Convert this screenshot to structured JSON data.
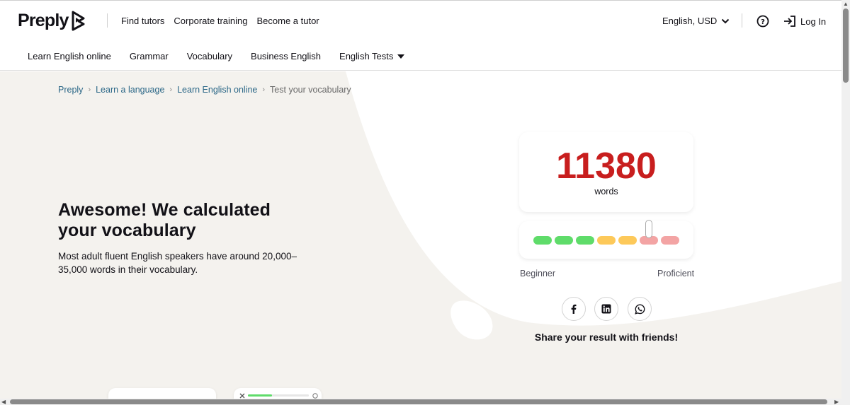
{
  "header": {
    "logo": "Preply",
    "links": [
      "Find tutors",
      "Corporate training",
      "Become a tutor"
    ],
    "locale": "English, USD",
    "login": "Log In"
  },
  "subnav": [
    "Learn English online",
    "Grammar",
    "Vocabulary",
    "Business English",
    "English Tests"
  ],
  "breadcrumb": {
    "links": [
      "Preply",
      "Learn a language",
      "Learn English online"
    ],
    "current": "Test your vocabulary"
  },
  "hero": {
    "headline": "Awesome! We calculated your vocabulary",
    "description": "Most adult fluent English speakers have around 20,000–35,000 words in their vocabulary."
  },
  "result": {
    "count": "11380",
    "unit": "words",
    "level_min": "Beginner",
    "level_max": "Proficient",
    "level_position": 0.79,
    "segment_colors": [
      "#5fdc6a",
      "#5fdc6a",
      "#5fdc6a",
      "#fdc95a",
      "#fdc95a",
      "#f3a4a4",
      "#f3a4a4"
    ]
  },
  "share": {
    "label": "Share your result with friends!",
    "networks": [
      "facebook-icon",
      "linkedin-icon",
      "whatsapp-icon"
    ]
  },
  "colors": {
    "accent": "#c81e1e",
    "link": "#2b6787",
    "background": "#f4f2ee"
  }
}
